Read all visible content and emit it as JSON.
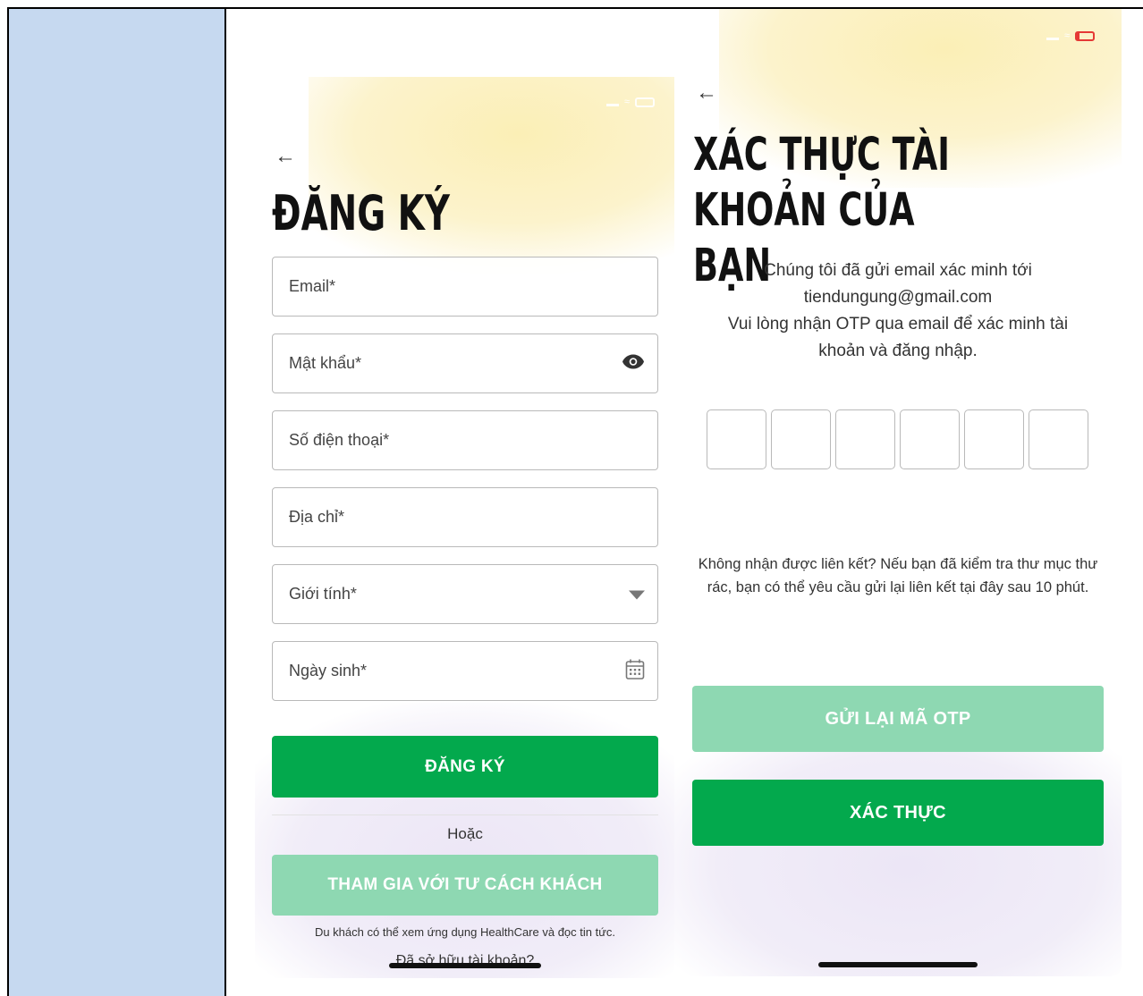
{
  "register": {
    "title": "ĐĂNG KÝ",
    "fields": [
      {
        "label": "Email*"
      },
      {
        "label": "Mật khẩu*"
      },
      {
        "label": "Số điện thoại*"
      },
      {
        "label": "Địa chỉ*"
      },
      {
        "label": "Giới tính*"
      },
      {
        "label": "Ngày sinh*"
      }
    ],
    "register_button": "ĐĂNG KÝ",
    "or_label": "Hoặc",
    "guest_button": "THAM GIA VỚI TƯ CÁCH KHÁCH",
    "guest_note": "Du khách có thể xem ứng dụng HealthCare và đọc tin tức.",
    "login_link": "Đã sở hữu tài khoản?"
  },
  "verify": {
    "title_line1": "XÁC THỰC TÀI KHOẢN CỦA",
    "title_line2": "BẠN",
    "message_line1": "Chúng tôi đã gửi email xác minh tới",
    "email": "tiendungung@gmail.com",
    "message_line2": "Vui lòng nhận OTP qua email để xác minh tài khoản và đăng nhập.",
    "otp_length": 6,
    "resend_note": "Không nhận được liên kết? Nếu bạn đã kiểm tra thư mục thư rác, bạn có thể yêu cầu gửi lại liên kết tại đây sau 10 phút.",
    "resend_button": "GỬI LẠI MÃ OTP",
    "verify_button": "XÁC THỰC"
  },
  "colors": {
    "primary": "#03a94d",
    "primary_light": "#8ed8b2",
    "left_cell": "#c6d9f0"
  }
}
